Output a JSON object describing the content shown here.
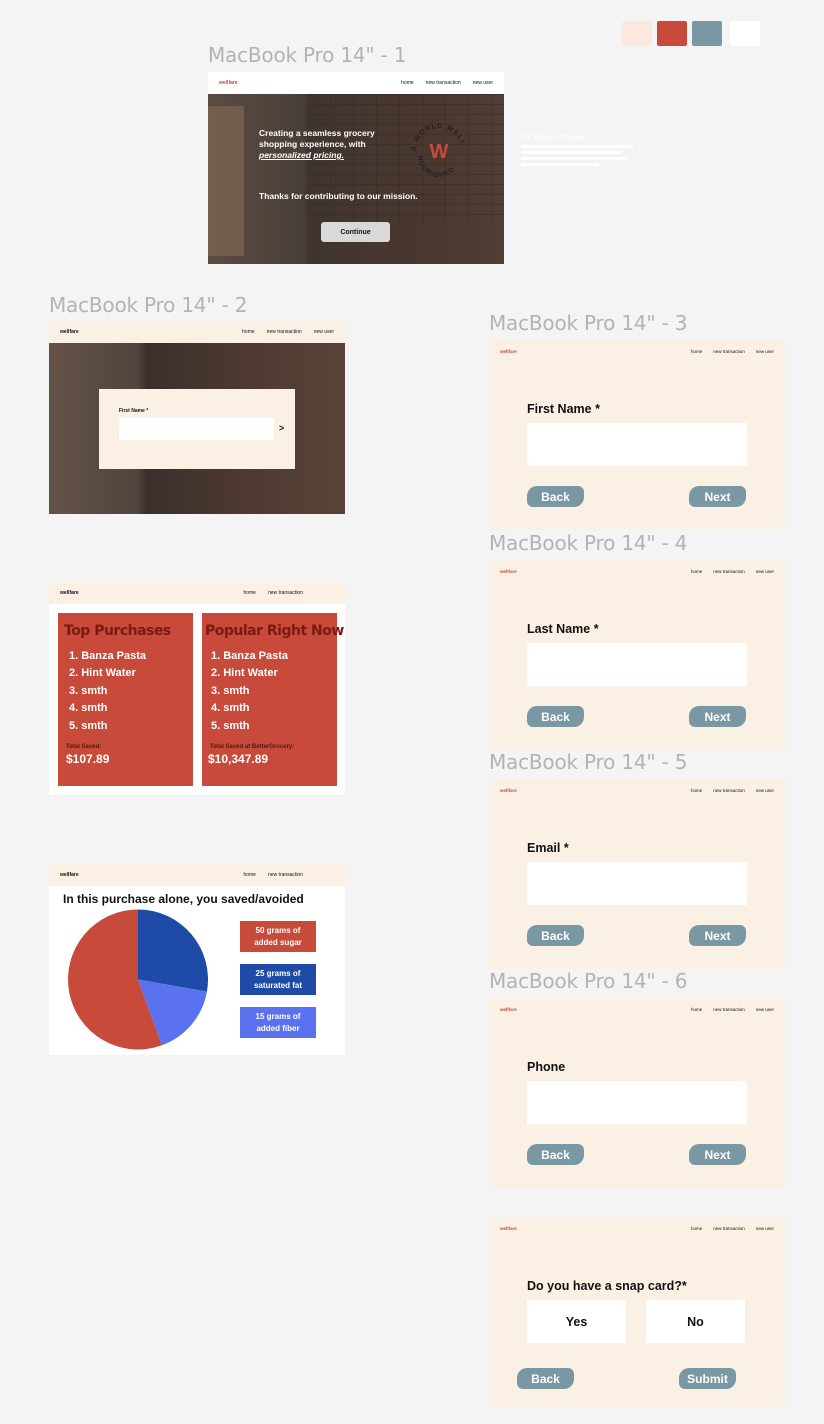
{
  "palette": [
    "#fbe9df",
    "#c74a3a",
    "#7a97a4",
    "#ffffff"
  ],
  "frame_labels": {
    "f1": "MacBook Pro 14\" - 1",
    "f2": "MacBook Pro 14\" - 2",
    "f3": "MacBook Pro 14\" - 3",
    "f4": "MacBook Pro 14\" - 4",
    "f5": "MacBook Pro 14\" - 5",
    "f6": "MacBook Pro 14\" - 6"
  },
  "brand": "wellfare",
  "nav": {
    "home": "home",
    "new_transaction": "new transaction",
    "new_user": "new user"
  },
  "landing": {
    "headline": "Creating a seamless grocery shopping experience, with",
    "headline_em": "personalized pricing.",
    "thanks": "Thanks for contributing to our mission.",
    "continue": "Continue",
    "theory_title": "Our Theory of Change"
  },
  "first_name_card": {
    "label": "First Name *",
    "arrow": ">"
  },
  "purchases": {
    "left": {
      "title": "Top Purchases",
      "items": [
        "1. Banza Pasta",
        "2. Hint Water",
        "3. smth",
        "4. smth",
        "5. smth"
      ],
      "saved_label": "Total Saved:",
      "saved_value": "$107.89"
    },
    "right": {
      "title": "Popular Right Now",
      "items": [
        "1. Banza Pasta",
        "2. Hint Water",
        "3. smth",
        "4. smth",
        "5. smth"
      ],
      "saved_label": "Total Saved at BetterGrocery:",
      "saved_value": "$10,347.89"
    }
  },
  "savings": {
    "heading": "In this purchase alone, you saved/avoided",
    "legend": [
      {
        "line1": "50 grams of",
        "line2": "added sugar",
        "color": "#c74a3a"
      },
      {
        "line1": "25 grams of",
        "line2": "saturated fat",
        "color": "#1e4aa8"
      },
      {
        "line1": "15 grams of",
        "line2": "added fiber",
        "color": "#5b72f0"
      }
    ]
  },
  "chart_data": {
    "type": "pie",
    "categories": [
      "added sugar",
      "saturated fat",
      "added fiber"
    ],
    "values": [
      50,
      25,
      15
    ],
    "colors": [
      "#c74a3a",
      "#1e4aa8",
      "#5b72f0"
    ]
  },
  "forms": {
    "first": {
      "label": "First Name *"
    },
    "last": {
      "label": "Last Name *"
    },
    "email": {
      "label": "Email *"
    },
    "phone": {
      "label": "Phone"
    },
    "snap": {
      "label": "Do you have a snap card?*",
      "yes": "Yes",
      "no": "No"
    },
    "back": "Back",
    "next": "Next",
    "submit": "Submit"
  }
}
